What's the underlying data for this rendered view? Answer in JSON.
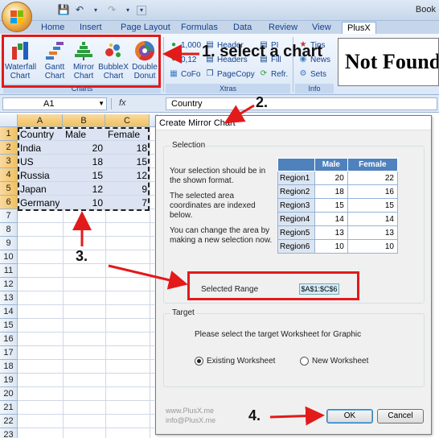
{
  "window": {
    "title": "Book"
  },
  "tabs": [
    {
      "label": "Home"
    },
    {
      "label": "Insert"
    },
    {
      "label": "Page Layout"
    },
    {
      "label": "Formulas"
    },
    {
      "label": "Data"
    },
    {
      "label": "Review"
    },
    {
      "label": "View"
    },
    {
      "label": "PlusX"
    }
  ],
  "ribbon": {
    "charts_group": {
      "label": "Charts",
      "buttons": [
        {
          "line1": "Waterfall",
          "line2": "Chart",
          "icon": "waterfall-chart-icon"
        },
        {
          "line1": "Gantt",
          "line2": "Chart",
          "icon": "gantt-chart-icon"
        },
        {
          "line1": "Mirror",
          "line2": "Chart",
          "icon": "mirror-chart-icon"
        },
        {
          "line1": "BubbleX",
          "line2": "Chart",
          "icon": "bubble-chart-icon"
        },
        {
          "line1": "Double",
          "line2": "Donut",
          "icon": "donut-chart-icon"
        }
      ]
    },
    "xtras_group": {
      "label": "Xtras",
      "items": [
        "1,000",
        "0,12",
        "CoFo",
        "Header",
        "Headers",
        "PageCopy",
        "PI",
        "Fill",
        "Refr."
      ]
    },
    "info_group": {
      "label": "Info",
      "items": [
        "Tips",
        "News",
        "Sets"
      ]
    },
    "not_found_text": "Not Found"
  },
  "formula_bar": {
    "name_box": "A1",
    "fx": "fx",
    "content": "Country"
  },
  "sheet": {
    "columns": [
      "A",
      "B",
      "C"
    ],
    "rows": [
      "1",
      "2",
      "3",
      "4",
      "5",
      "6",
      "7",
      "8",
      "9",
      "10",
      "11",
      "12",
      "13",
      "14",
      "15",
      "16",
      "17",
      "18",
      "19",
      "20",
      "21",
      "22",
      "23"
    ],
    "cells": [
      [
        "Country",
        "Male",
        "Female"
      ],
      [
        "India",
        "20",
        "18"
      ],
      [
        "US",
        "18",
        "15"
      ],
      [
        "Russia",
        "15",
        "12"
      ],
      [
        "Japan",
        "12",
        "9"
      ],
      [
        "Germany",
        "10",
        "7"
      ]
    ]
  },
  "dialog": {
    "title": "Create Mirror Chart",
    "selection_legend": "Selection",
    "desc1_l1": "Your selection should be in",
    "desc1_l2": "the shown format.",
    "desc2_l1": "The selected area",
    "desc2_l2": "coordinates are indexed",
    "desc2_l3": "below.",
    "desc3_l1": "You can change the area by",
    "desc3_l2": "making a new selection now.",
    "sample_headers": [
      "",
      "Male",
      "Female"
    ],
    "sample_rows": [
      [
        "Region1",
        "20",
        "22"
      ],
      [
        "Region2",
        "18",
        "16"
      ],
      [
        "Region3",
        "15",
        "15"
      ],
      [
        "Region4",
        "14",
        "14"
      ],
      [
        "Region5",
        "13",
        "13"
      ],
      [
        "Region6",
        "10",
        "10"
      ]
    ],
    "selected_range_label": "Selected Range",
    "selected_range_value": "$A$1:$C$6",
    "target_legend": "Target",
    "target_prompt": "Please select the target Worksheet for Graphic",
    "existing_label": "Existing Worksheet",
    "new_label": "New Worksheet",
    "footer_l1": "www.PlusX.me",
    "footer_l2": "info@PlusX.me",
    "ok_label": "OK",
    "cancel_label": "Cancel"
  },
  "annotations": {
    "step1": "1. select a chart",
    "step2": "2.",
    "step3": "3.",
    "step4": "4.",
    "color": "#e21a1a"
  }
}
